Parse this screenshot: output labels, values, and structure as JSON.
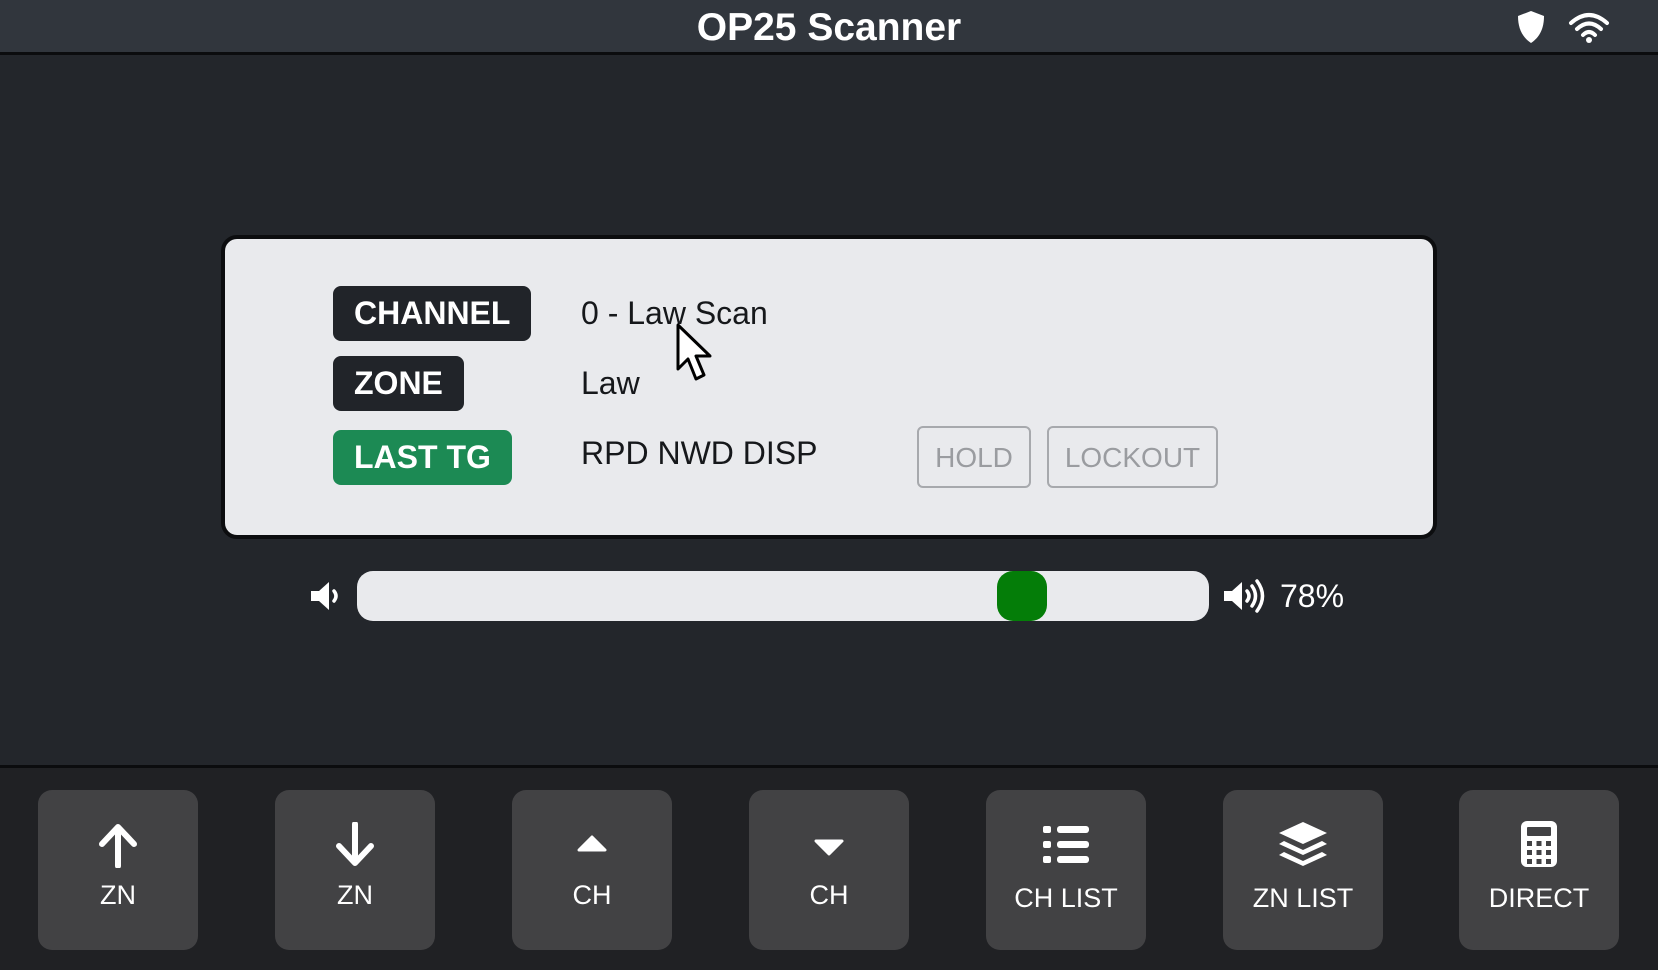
{
  "app": {
    "title": "OP25 Scanner",
    "status_icons": [
      "shield-icon",
      "wifi-icon"
    ]
  },
  "info": {
    "channel_label": "CHANNEL",
    "channel_value": "0 - Law Scan",
    "zone_label": "ZONE",
    "zone_value": "Law",
    "last_tg_label": "LAST TG",
    "last_tg_value": "RPD NWD DISP",
    "hold_label": "HOLD",
    "lockout_label": "LOCKOUT"
  },
  "volume": {
    "level": 0.78,
    "display": "78%",
    "low_icon": "volume-low-icon",
    "high_icon": "volume-high-icon"
  },
  "controls": [
    {
      "label": "ZN",
      "icon": "arrow-up-icon"
    },
    {
      "label": "ZN",
      "icon": "arrow-down-icon"
    },
    {
      "label": "CH",
      "icon": "caret-up-icon"
    },
    {
      "label": "CH",
      "icon": "caret-down-icon"
    },
    {
      "label": "CH LIST",
      "icon": "list-icon"
    },
    {
      "label": "ZN LIST",
      "icon": "layers-icon"
    },
    {
      "label": "DIRECT",
      "icon": "calculator-icon"
    }
  ],
  "colors": {
    "background": "#23262b",
    "titlebar": "#31363d",
    "panel": "#e9eaed",
    "label_dark": "#212429",
    "label_green": "#1c8a54",
    "volume_thumb": "#047d08",
    "button": "#424244"
  }
}
